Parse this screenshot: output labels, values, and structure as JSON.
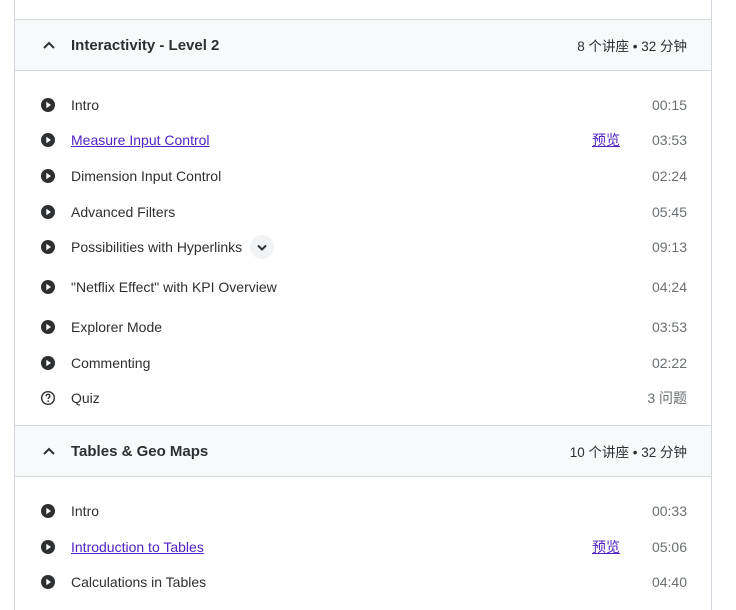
{
  "sections": [
    {
      "title": "Interactivity - Level 2",
      "meta": "8 个讲座 • 32 分钟",
      "items": [
        {
          "type": "video",
          "title": "Intro",
          "duration": "00:15"
        },
        {
          "type": "video",
          "title": "Measure Input Control",
          "duration": "03:53",
          "preview": "预览"
        },
        {
          "type": "video",
          "title": "Dimension Input Control",
          "duration": "02:24"
        },
        {
          "type": "video",
          "title": "Advanced Filters",
          "duration": "05:45"
        },
        {
          "type": "video",
          "title": "Possibilities with Hyperlinks",
          "duration": "09:13"
        },
        {
          "type": "video",
          "title": "\"Netflix Effect\" with KPI Overview",
          "duration": "04:24"
        },
        {
          "type": "video",
          "title": "Explorer Mode",
          "duration": "03:53"
        },
        {
          "type": "video",
          "title": "Commenting",
          "duration": "02:22"
        },
        {
          "type": "quiz",
          "title": "Quiz",
          "duration": "3 问题"
        }
      ]
    },
    {
      "title": "Tables & Geo Maps",
      "meta": "10 个讲座 • 32 分钟",
      "items": [
        {
          "type": "video",
          "title": "Intro",
          "duration": "00:33"
        },
        {
          "type": "video",
          "title": "Introduction to Tables",
          "duration": "05:06",
          "preview": "预览"
        },
        {
          "type": "video",
          "title": "Calculations in Tables",
          "duration": "04:40"
        }
      ]
    }
  ]
}
